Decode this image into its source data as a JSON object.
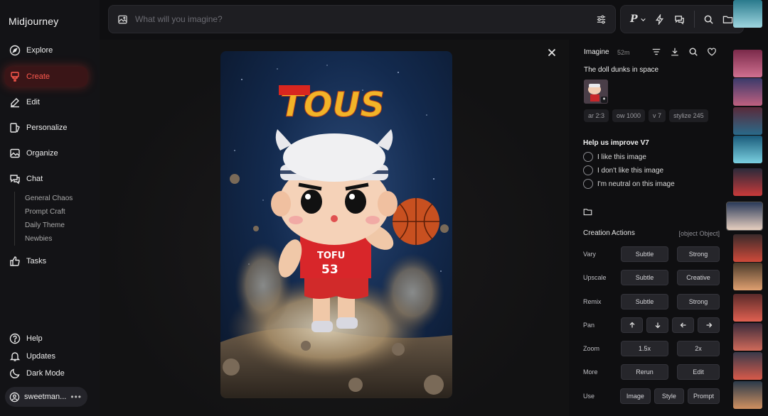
{
  "app": {
    "name": "Midjourney"
  },
  "sidebar": {
    "items": [
      {
        "label": "Explore",
        "icon": "compass-icon",
        "active": false
      },
      {
        "label": "Create",
        "icon": "brush-icon",
        "active": true
      },
      {
        "label": "Edit",
        "icon": "edit-icon",
        "active": false
      },
      {
        "label": "Personalize",
        "icon": "personalize-icon",
        "active": false
      },
      {
        "label": "Organize",
        "icon": "image-icon",
        "active": false
      },
      {
        "label": "Chat",
        "icon": "chat-icon",
        "active": false
      }
    ],
    "chat_rooms": [
      "General Chaos",
      "Prompt Craft",
      "Daily Theme",
      "Newbies"
    ],
    "tasks_label": "Tasks",
    "footer": [
      {
        "label": "Help",
        "icon": "help-icon"
      },
      {
        "label": "Updates",
        "icon": "bell-icon"
      },
      {
        "label": "Dark Mode",
        "icon": "moon-icon"
      }
    ],
    "user": {
      "name": "sweetman..."
    }
  },
  "topbar": {
    "search_placeholder": "What will you imagine?",
    "profile_letter": "P"
  },
  "detail": {
    "title": "Imagine",
    "time": "52m",
    "prompt": "The doll dunks in space",
    "params": [
      "ar 2:3",
      "ow 1000",
      "v 7",
      "stylize 245"
    ],
    "feedback": {
      "title": "Help us improve V7",
      "options": [
        "I like this image",
        "I don't like this image",
        "I'm neutral on this image"
      ]
    },
    "creation_actions": {
      "title": "Creation Actions",
      "more": {
        "label": "More",
        "buttons": [
          "Rerun",
          "Edit"
        ]
      },
      "vary": {
        "label": "Vary",
        "buttons": [
          "Subtle",
          "Strong"
        ]
      },
      "upscale": {
        "label": "Upscale",
        "buttons": [
          "Subtle",
          "Creative"
        ]
      },
      "remix": {
        "label": "Remix",
        "buttons": [
          "Subtle",
          "Strong"
        ]
      },
      "pan": {
        "label": "Pan",
        "buttons": [
          "up",
          "down",
          "left",
          "right"
        ]
      },
      "zoom": {
        "label": "Zoom",
        "buttons": [
          "1.5x",
          "2x"
        ]
      },
      "use": {
        "label": "Use",
        "buttons": [
          "Image",
          "Style",
          "Prompt"
        ]
      }
    }
  },
  "artwork": {
    "title_text": "TOUS",
    "jersey_name": "TOFU",
    "jersey_number": "53"
  },
  "colors": {
    "accent": "#ff5a4e",
    "active_bg": "#3a1517",
    "background": "#0f0f11"
  }
}
